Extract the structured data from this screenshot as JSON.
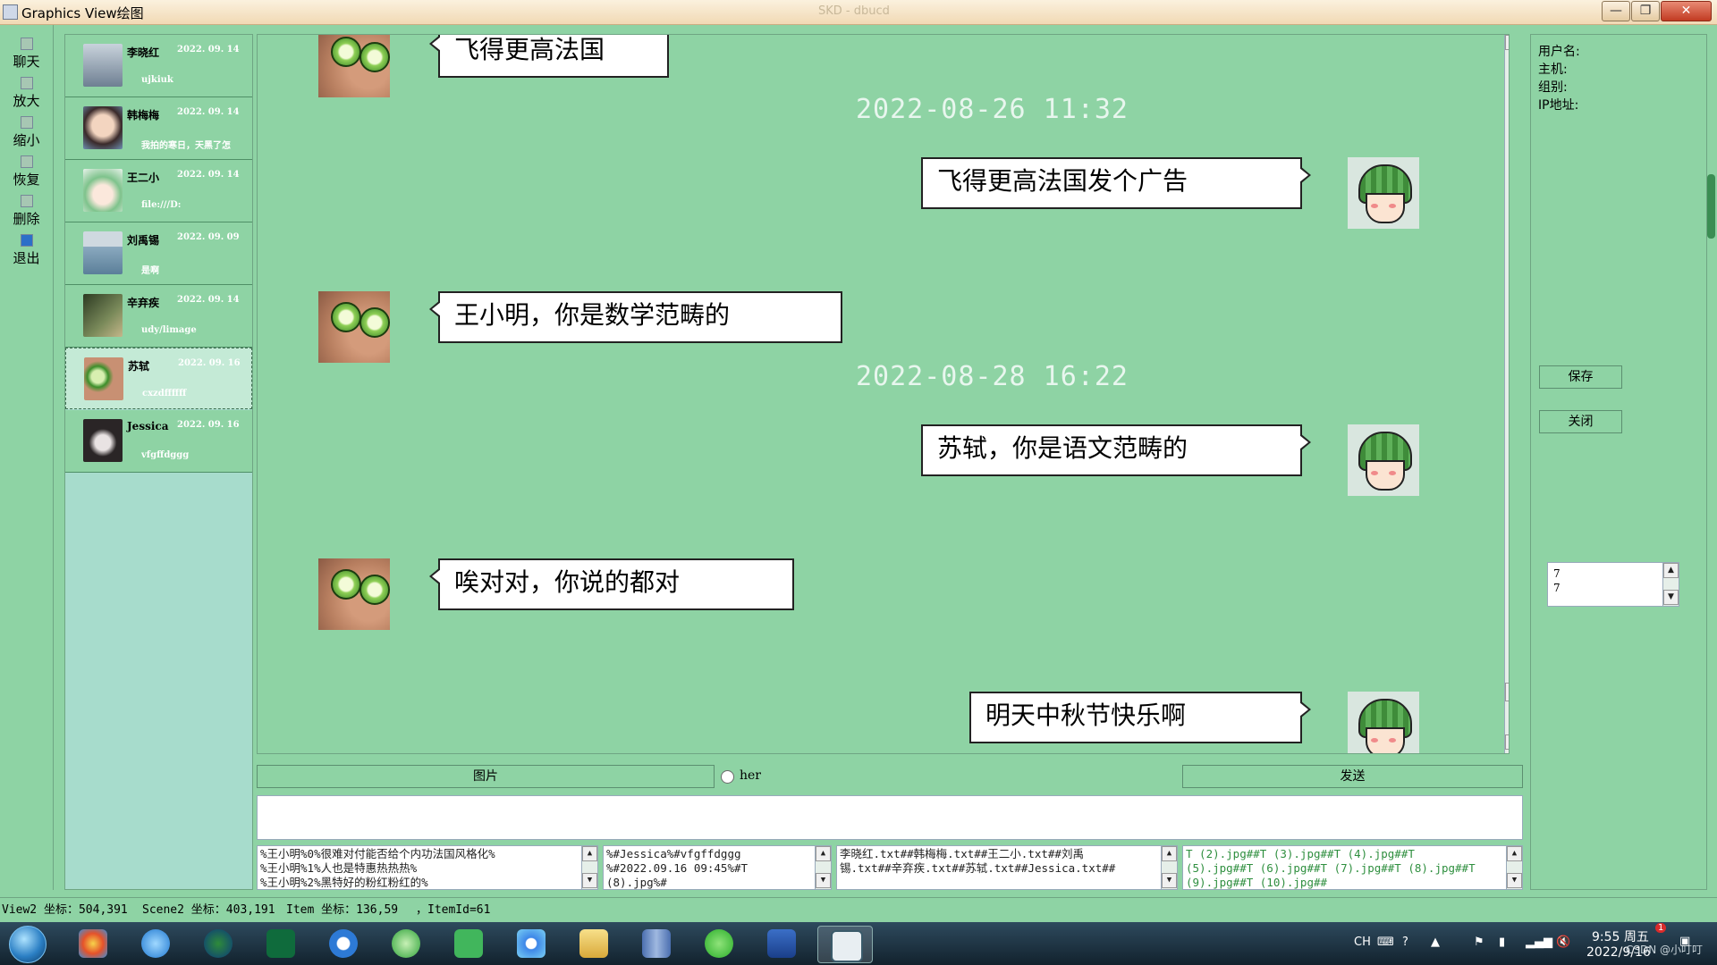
{
  "window": {
    "title": "Graphics View绘图",
    "center_title": "SKD - dbucd",
    "btn_min": "—",
    "btn_max": "❐",
    "btn_close": "✕"
  },
  "toolbar": [
    {
      "label": "聊天",
      "icon": "chat-icon"
    },
    {
      "label": "放大",
      "icon": "zoom-in-icon"
    },
    {
      "label": "缩小",
      "icon": "zoom-out-icon"
    },
    {
      "label": "恢复",
      "icon": "restore-icon"
    },
    {
      "label": "删除",
      "icon": "delete-icon"
    },
    {
      "label": "退出",
      "icon": "exit-icon"
    }
  ],
  "contacts": [
    {
      "name": "李晓红",
      "date": "2022. 09. 14",
      "msg": "ujkiuk"
    },
    {
      "name": "韩梅梅",
      "date": "2022. 09. 14",
      "msg": "我拍的寒日，天黑了怎"
    },
    {
      "name": "王二小",
      "date": "2022. 09. 14",
      "msg": "file:///D:"
    },
    {
      "name": "刘禹锡",
      "date": "2022. 09. 09",
      "msg": "是啊"
    },
    {
      "name": "辛弃疾",
      "date": "2022. 09. 14",
      "msg": "udy/limage"
    },
    {
      "name": "苏轼",
      "date": "2022. 09. 16",
      "msg": "cxzdffffff"
    },
    {
      "name": "Jessica",
      "date": "2022. 09. 16",
      "msg": "vfgffdggg"
    }
  ],
  "chat": {
    "messages": [
      {
        "side": "left",
        "text": "飞得更高法国"
      },
      {
        "side": "timestamp",
        "text": "2022-08-26 11:32"
      },
      {
        "side": "right",
        "text": "飞得更高法国发个广告"
      },
      {
        "side": "left",
        "text": "王小明，你是数学范畴的"
      },
      {
        "side": "timestamp",
        "text": "2022-08-28 16:22"
      },
      {
        "side": "right",
        "text": "苏轼，你是语文范畴的"
      },
      {
        "side": "left",
        "text": "唉对对，你说的都对"
      },
      {
        "side": "right",
        "text": "明天中秋节快乐啊"
      }
    ]
  },
  "actions": {
    "image_button": "图片",
    "radio_label": "her",
    "send_button": "发送",
    "message_input_value": ""
  },
  "logs": [
    [
      "%王小明%0%很难对付能否给个内功法国风格化%",
      "%王小明%1%人也是特惠热热热%",
      "%王小明%2%黑特好的粉红粉红的%"
    ],
    [
      "%#Jessica%#vfgffdggg",
      "%#2022.09.16 09:45%#T",
      "(8).jpg%#"
    ],
    [
      "李晓红.txt##韩梅梅.txt##王二小.txt##刘禹",
      "锡.txt##辛弃疾.txt##苏轼.txt##Jessica.txt##"
    ],
    [
      "T (2).jpg##T (3).jpg##T (4).jpg##T",
      "(5).jpg##T (6).jpg##T (7).jpg##T (8).jpg##T",
      "(9).jpg##T (10).jpg##"
    ]
  ],
  "info": {
    "username_label": "用户名:",
    "host_label": "主机:",
    "group_label": "组别:",
    "ip_label": "IP地址:",
    "save_button": "保存",
    "close_button": "关闭",
    "spin_lines": [
      "7",
      "7"
    ]
  },
  "statusbar": {
    "view": "View2 坐标：504,391",
    "scene": "Scene2 坐标：403,191",
    "item": "Item 坐标：136,59",
    "item_id": "，ItemId=61"
  },
  "taskbar": {
    "apps": [
      "paint-icon",
      "ie-icon",
      "wxf-icon",
      "monitor-icon",
      "sogou-icon",
      "browser-icon",
      "qt-icon",
      "baidu-netdisk-icon",
      "explorer-icon",
      "buildings-icon",
      "wechat-icon",
      "word-icon",
      "window-icon"
    ],
    "lang": "CH",
    "time": "9:55 周五",
    "date": "2022/9/16",
    "watermark": "CSDN @小叮叮",
    "badge": "1"
  }
}
